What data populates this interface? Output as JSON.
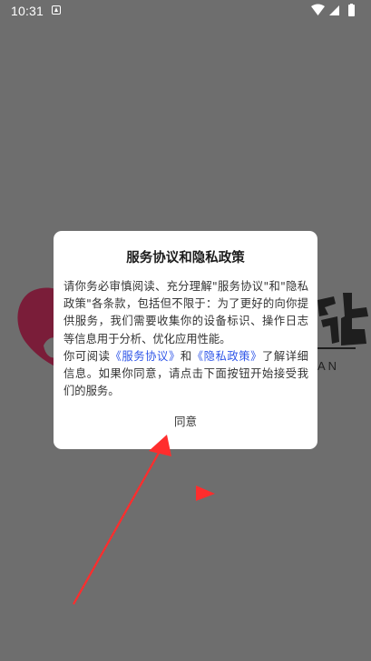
{
  "status_bar": {
    "time": "10:31"
  },
  "background": {
    "logo_subtext": "AN"
  },
  "dialog": {
    "title": "服务协议和隐私政策",
    "paragraph1": "请你务必审慎阅读、充分理解\"服务协议\"和\"隐私政策\"各条款，包括但不限于：为了更好的向你提供服务，我们需要收集你的设备标识、操作日志等信息用于分析、优化应用性能。",
    "paragraph2_prefix": "你可阅读",
    "service_link": "《服务协议》",
    "paragraph2_and": "和",
    "privacy_link": "《隐私政策》",
    "paragraph2_suffix": "了解详细信息。如果你同意，请点击下面按钮开始接受我们的服务。",
    "agree_label": "同意"
  },
  "colors": {
    "overlay": "#6e6e6e",
    "link": "#2f56e8",
    "annotation_red": "#ff2d2d"
  }
}
